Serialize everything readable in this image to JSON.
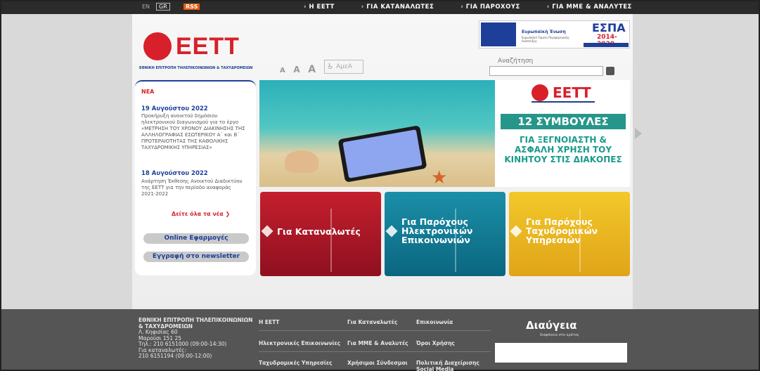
{
  "topbar": {
    "lang_en": "EN",
    "lang_gr": "GR",
    "rss": "RSS",
    "nav": [
      "Η ΕΕΤΤ",
      "ΓΙΑ ΚΑΤΑΝΑΛΩΤΕΣ",
      "ΓΙΑ ΠΑΡΟΧΟΥΣ",
      "ΓΙΑ ΜΜΕ & ΑΝΑΛΥΤΕΣ"
    ]
  },
  "header": {
    "brand": "ΕΕΤΤ",
    "brand_sub": "ΕΘΝΙΚΗ ΕΠΙΤΡΟΠΗ ΤΗΛΕΠΙΚΟΙΝΩΝΙΩΝ & ΤΑΧΥΔΡΟΜΕΙΩΝ",
    "font_sizes": [
      "A",
      "A",
      "A"
    ],
    "amea": "ΑμεΑ",
    "espa": {
      "eu": "Ευρωπαϊκή Ένωση",
      "eu_sub": "Ευρωπαϊκό Ταμείο Περιφερειακής Ανάπτυξης",
      "title": "ΕΣΠΑ",
      "years": "2014-2020"
    },
    "search": {
      "label": "Αναζήτηση",
      "value": ""
    }
  },
  "news": {
    "heading": "ΝΕΑ",
    "items": [
      {
        "date": "19 Αυγούστου 2022",
        "text": "Προκήρυξη ανοικτού δημόσιου ηλεκτρονικού διαγωνισμού για το έργο «ΜΕΤΡΗΣΗ ΤΟΥ ΧΡΟΝΟΥ ΔΙΑΚΙΝΗΣΗΣ ΤΗΣ ΑΛΛΗΛΟΓΡΑΦΙΑΣ ΕΣΩΤΕΡΙΚΟΥ Α΄ και Β΄ ΠΡΟΤΕΡΑΙΟΤΗΤΑΣ ΤΗΣ ΚΑΘΟΛΙΚΗΣ ΤΑΧΥΔΡΟΜΙΚΗΣ ΥΠΗΡΕΣΙΑΣ»"
      },
      {
        "date": "18 Αυγούστου 2022",
        "text": "Ανάρτηση Έκθεσης Ανοικτού Διαδικτύου της ΕΕΤΤ για την περίοδο αναφοράς 2021-2022"
      }
    ],
    "see_all": "Δείτε όλα τα νέα ❯",
    "online_apps": "Online Εφαρμογές",
    "newsletter": "Εγγραφή στο newsletter"
  },
  "banner": {
    "brand": "ΕΕΤΤ",
    "tips_title": "12 ΣΥΜΒΟΥΛΕΣ",
    "tips_text": "ΓΙΑ ΞΕΓΝΟΙΑΣΤΗ & ΑΣΦΑΛΗ ΧΡΗΣΗ ΤΟΥ ΚΙΝΗΤΟΥ ΣΤΙΣ ΔΙΑΚΟΠΕΣ"
  },
  "tiles": [
    {
      "label": "Για Καταναλωτές",
      "color": "#c41f2d"
    },
    {
      "label": "Για Παρόχους Ηλεκτρονικών Επικοινωνιών",
      "color": "#1b8fa8"
    },
    {
      "label": "Για Παρόχους Ταχυδρομικών Υπηρεσιών",
      "color": "#f3c82a"
    }
  ],
  "footer": {
    "org": "ΕΘΝΙΚΗ ΕΠΙΤΡΟΠΗ ΤΗΛΕΠΙΚΟΙΝΩΝΙΩΝ & ΤΑΧΥΔΡΟΜΕΙΩΝ",
    "address1": "Λ. Κηφισίας 60",
    "address2": "Μαρούσι 151 25",
    "phone": "Τηλ.: 210 6151000 (09:00-14:30)",
    "consumers": "Για καταναλωτές:",
    "consumers_phone": "210 6151194 (09:00-12:00)",
    "links": [
      "Η ΕΕΤΤ",
      "Για Καταναλωτές",
      "Επικοινωνία",
      "Ηλεκτρονικές Επικοινωνίες",
      "Για ΜΜΕ & Αναλυτές",
      "Όροι Χρήσης",
      "Ταχυδρομικές Υπηρεσίες",
      "Χρήσιμοι Σύνδεσμοι",
      "Πολιτική Διαχείρισης Social Media"
    ],
    "diavgeia": "Διαύγεια",
    "diavgeia_sub": "διαφάνεια στο κράτος"
  },
  "colors": {
    "brand_red": "#d8202a",
    "brand_blue": "#1d3f9a",
    "teal": "#27968a"
  }
}
